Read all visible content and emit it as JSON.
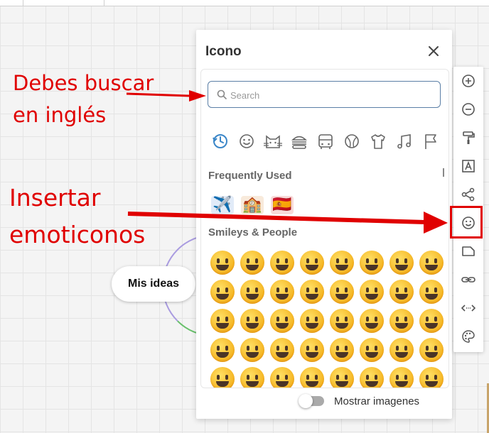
{
  "annotations": {
    "search_hint_line1": "Debes buscar",
    "search_hint_line2": "en inglés",
    "emoji_hint_line1": "Insertar",
    "emoji_hint_line2": "emoticonos"
  },
  "canvas": {
    "node_label": "Mis ideas"
  },
  "panel": {
    "title": "Icono",
    "search_placeholder": "Search",
    "categories": [
      "recent-icon",
      "smiley-icon",
      "cat-icon",
      "burger-icon",
      "bus-icon",
      "ball-icon",
      "shirt-icon",
      "music-icon",
      "flag-icon"
    ],
    "sections": [
      {
        "label": "Frequently Used",
        "emojis": [
          "✈️",
          "🏫",
          "🇪🇸"
        ]
      },
      {
        "label": "Smileys & People",
        "emojis": [
          "😀",
          "😃",
          "😄",
          "😁",
          "😆",
          "😅",
          "🤣",
          "😂",
          "🙂",
          "🙃",
          "🫠",
          "😉",
          "😊",
          "😇",
          "🥰",
          "😍",
          "🤩",
          "😘",
          "😗",
          "☺️",
          "😚",
          "😙",
          "🥲",
          "😋",
          "😛",
          "😜",
          "🤪",
          "😝",
          "🤑",
          "🤗",
          "🤭",
          "🫢",
          "🫣",
          "🤫",
          "🤔",
          "🫡",
          "🤐",
          "🤨",
          "😐",
          "😑"
        ]
      }
    ],
    "footer": {
      "toggle_label": "Mostrar imagenes",
      "toggle_on": false
    }
  },
  "toolbar": {
    "buttons": [
      "zoom-in-icon",
      "zoom-out-icon",
      "paint-roller-icon",
      "text-box-icon",
      "share-icon",
      "emoji-icon",
      "note-icon",
      "link-icon",
      "code-icon",
      "palette-icon"
    ],
    "active": "emoji-icon"
  },
  "colors": {
    "annotation": "#e00000",
    "search_border": "#5b7fa6",
    "accent_blue": "#3a86c8"
  }
}
